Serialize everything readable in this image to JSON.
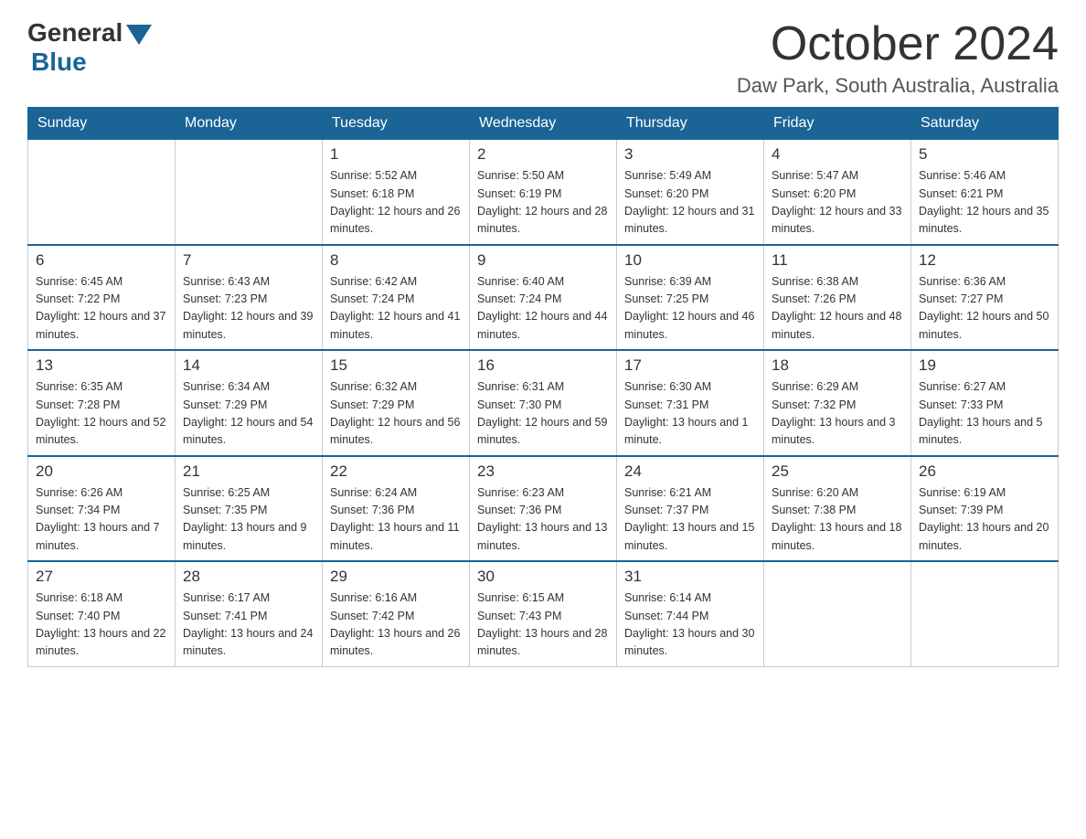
{
  "header": {
    "logo_general": "General",
    "logo_blue": "Blue",
    "month_title": "October 2024",
    "location": "Daw Park, South Australia, Australia"
  },
  "weekdays": [
    "Sunday",
    "Monday",
    "Tuesday",
    "Wednesday",
    "Thursday",
    "Friday",
    "Saturday"
  ],
  "weeks": [
    [
      {
        "day": "",
        "sunrise": "",
        "sunset": "",
        "daylight": ""
      },
      {
        "day": "",
        "sunrise": "",
        "sunset": "",
        "daylight": ""
      },
      {
        "day": "1",
        "sunrise": "Sunrise: 5:52 AM",
        "sunset": "Sunset: 6:18 PM",
        "daylight": "Daylight: 12 hours and 26 minutes."
      },
      {
        "day": "2",
        "sunrise": "Sunrise: 5:50 AM",
        "sunset": "Sunset: 6:19 PM",
        "daylight": "Daylight: 12 hours and 28 minutes."
      },
      {
        "day": "3",
        "sunrise": "Sunrise: 5:49 AM",
        "sunset": "Sunset: 6:20 PM",
        "daylight": "Daylight: 12 hours and 31 minutes."
      },
      {
        "day": "4",
        "sunrise": "Sunrise: 5:47 AM",
        "sunset": "Sunset: 6:20 PM",
        "daylight": "Daylight: 12 hours and 33 minutes."
      },
      {
        "day": "5",
        "sunrise": "Sunrise: 5:46 AM",
        "sunset": "Sunset: 6:21 PM",
        "daylight": "Daylight: 12 hours and 35 minutes."
      }
    ],
    [
      {
        "day": "6",
        "sunrise": "Sunrise: 6:45 AM",
        "sunset": "Sunset: 7:22 PM",
        "daylight": "Daylight: 12 hours and 37 minutes."
      },
      {
        "day": "7",
        "sunrise": "Sunrise: 6:43 AM",
        "sunset": "Sunset: 7:23 PM",
        "daylight": "Daylight: 12 hours and 39 minutes."
      },
      {
        "day": "8",
        "sunrise": "Sunrise: 6:42 AM",
        "sunset": "Sunset: 7:24 PM",
        "daylight": "Daylight: 12 hours and 41 minutes."
      },
      {
        "day": "9",
        "sunrise": "Sunrise: 6:40 AM",
        "sunset": "Sunset: 7:24 PM",
        "daylight": "Daylight: 12 hours and 44 minutes."
      },
      {
        "day": "10",
        "sunrise": "Sunrise: 6:39 AM",
        "sunset": "Sunset: 7:25 PM",
        "daylight": "Daylight: 12 hours and 46 minutes."
      },
      {
        "day": "11",
        "sunrise": "Sunrise: 6:38 AM",
        "sunset": "Sunset: 7:26 PM",
        "daylight": "Daylight: 12 hours and 48 minutes."
      },
      {
        "day": "12",
        "sunrise": "Sunrise: 6:36 AM",
        "sunset": "Sunset: 7:27 PM",
        "daylight": "Daylight: 12 hours and 50 minutes."
      }
    ],
    [
      {
        "day": "13",
        "sunrise": "Sunrise: 6:35 AM",
        "sunset": "Sunset: 7:28 PM",
        "daylight": "Daylight: 12 hours and 52 minutes."
      },
      {
        "day": "14",
        "sunrise": "Sunrise: 6:34 AM",
        "sunset": "Sunset: 7:29 PM",
        "daylight": "Daylight: 12 hours and 54 minutes."
      },
      {
        "day": "15",
        "sunrise": "Sunrise: 6:32 AM",
        "sunset": "Sunset: 7:29 PM",
        "daylight": "Daylight: 12 hours and 56 minutes."
      },
      {
        "day": "16",
        "sunrise": "Sunrise: 6:31 AM",
        "sunset": "Sunset: 7:30 PM",
        "daylight": "Daylight: 12 hours and 59 minutes."
      },
      {
        "day": "17",
        "sunrise": "Sunrise: 6:30 AM",
        "sunset": "Sunset: 7:31 PM",
        "daylight": "Daylight: 13 hours and 1 minute."
      },
      {
        "day": "18",
        "sunrise": "Sunrise: 6:29 AM",
        "sunset": "Sunset: 7:32 PM",
        "daylight": "Daylight: 13 hours and 3 minutes."
      },
      {
        "day": "19",
        "sunrise": "Sunrise: 6:27 AM",
        "sunset": "Sunset: 7:33 PM",
        "daylight": "Daylight: 13 hours and 5 minutes."
      }
    ],
    [
      {
        "day": "20",
        "sunrise": "Sunrise: 6:26 AM",
        "sunset": "Sunset: 7:34 PM",
        "daylight": "Daylight: 13 hours and 7 minutes."
      },
      {
        "day": "21",
        "sunrise": "Sunrise: 6:25 AM",
        "sunset": "Sunset: 7:35 PM",
        "daylight": "Daylight: 13 hours and 9 minutes."
      },
      {
        "day": "22",
        "sunrise": "Sunrise: 6:24 AM",
        "sunset": "Sunset: 7:36 PM",
        "daylight": "Daylight: 13 hours and 11 minutes."
      },
      {
        "day": "23",
        "sunrise": "Sunrise: 6:23 AM",
        "sunset": "Sunset: 7:36 PM",
        "daylight": "Daylight: 13 hours and 13 minutes."
      },
      {
        "day": "24",
        "sunrise": "Sunrise: 6:21 AM",
        "sunset": "Sunset: 7:37 PM",
        "daylight": "Daylight: 13 hours and 15 minutes."
      },
      {
        "day": "25",
        "sunrise": "Sunrise: 6:20 AM",
        "sunset": "Sunset: 7:38 PM",
        "daylight": "Daylight: 13 hours and 18 minutes."
      },
      {
        "day": "26",
        "sunrise": "Sunrise: 6:19 AM",
        "sunset": "Sunset: 7:39 PM",
        "daylight": "Daylight: 13 hours and 20 minutes."
      }
    ],
    [
      {
        "day": "27",
        "sunrise": "Sunrise: 6:18 AM",
        "sunset": "Sunset: 7:40 PM",
        "daylight": "Daylight: 13 hours and 22 minutes."
      },
      {
        "day": "28",
        "sunrise": "Sunrise: 6:17 AM",
        "sunset": "Sunset: 7:41 PM",
        "daylight": "Daylight: 13 hours and 24 minutes."
      },
      {
        "day": "29",
        "sunrise": "Sunrise: 6:16 AM",
        "sunset": "Sunset: 7:42 PM",
        "daylight": "Daylight: 13 hours and 26 minutes."
      },
      {
        "day": "30",
        "sunrise": "Sunrise: 6:15 AM",
        "sunset": "Sunset: 7:43 PM",
        "daylight": "Daylight: 13 hours and 28 minutes."
      },
      {
        "day": "31",
        "sunrise": "Sunrise: 6:14 AM",
        "sunset": "Sunset: 7:44 PM",
        "daylight": "Daylight: 13 hours and 30 minutes."
      },
      {
        "day": "",
        "sunrise": "",
        "sunset": "",
        "daylight": ""
      },
      {
        "day": "",
        "sunrise": "",
        "sunset": "",
        "daylight": ""
      }
    ]
  ]
}
